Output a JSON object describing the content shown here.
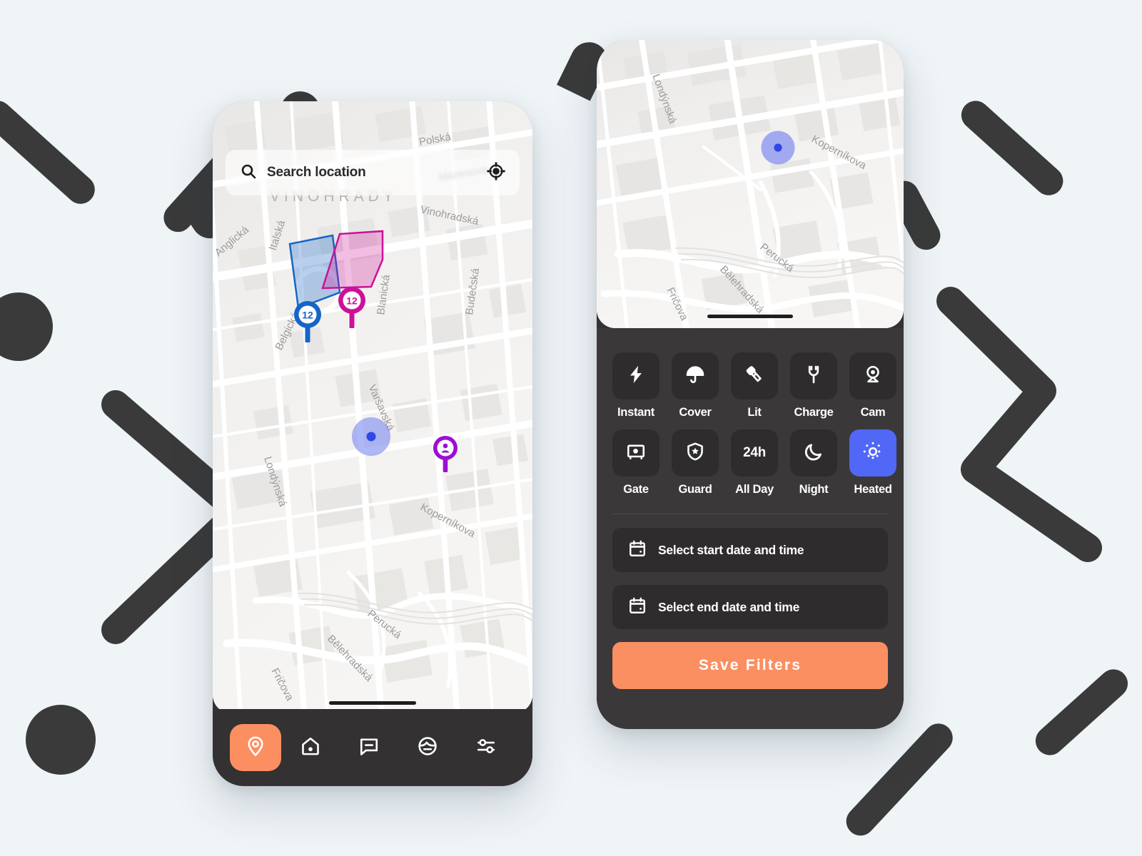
{
  "theme": {
    "background": "#eff4f7",
    "decor": "#3a3a3a",
    "phone_frame": "#333132",
    "panel": "#3a3839",
    "tile": "#2e2c2d",
    "accent_orange": "#fb8f62",
    "accent_blue": "#5167f6",
    "map_bg": "#f1efed",
    "pin_blue": "#1565c8",
    "pin_magenta": "#cc1199",
    "pin_purple": "#9b0fd4",
    "user_dot": "#6e7ef0"
  },
  "left_phone": {
    "search": {
      "placeholder": "Search location",
      "value": "Search location",
      "search_icon": "search-icon",
      "locate_icon": "crosshair-locate-icon"
    },
    "map": {
      "district_label": "VINOHRADY",
      "streets": [
        "Polská",
        "Mánesova",
        "Vinohradská",
        "Italská",
        "Anglická",
        "Blanická",
        "Budečská",
        "Belgická",
        "Varšavská",
        "Londýnská",
        "Koperníkova",
        "Perucká",
        "Bělehradská",
        "Fričova"
      ],
      "markers": [
        {
          "name": "cluster-blue",
          "label": "12",
          "color": "#1565c8"
        },
        {
          "name": "cluster-magenta",
          "label": "12",
          "color": "#cc1199"
        },
        {
          "name": "user-location-dot",
          "label": "",
          "color": "#6e7ef0"
        },
        {
          "name": "person-marker",
          "label": "",
          "color": "#9b0fd4"
        }
      ]
    },
    "bottom_nav": [
      {
        "icon": "map-pin-icon",
        "name": "nav-map",
        "active": true
      },
      {
        "icon": "home-icon",
        "name": "nav-home",
        "active": false
      },
      {
        "icon": "chat-bubble-icon",
        "name": "nav-messages",
        "active": false
      },
      {
        "icon": "face-avatar-icon",
        "name": "nav-profile",
        "active": false
      },
      {
        "icon": "sliders-icon",
        "name": "nav-filters",
        "active": false
      }
    ]
  },
  "right_phone": {
    "map": {
      "streets": [
        "Londýnská",
        "Koperníkova",
        "Perucká",
        "Bělehradská",
        "Fričova"
      ],
      "markers": [
        {
          "name": "user-location-dot",
          "color": "#6e7ef0"
        }
      ]
    },
    "filters": {
      "row1": [
        {
          "label": "Instant",
          "icon": "lightning-bolt-icon",
          "active": false
        },
        {
          "label": "Cover",
          "icon": "umbrella-icon",
          "active": false
        },
        {
          "label": "Lit",
          "icon": "flashlight-icon",
          "active": false
        },
        {
          "label": "Charge",
          "icon": "power-plug-icon",
          "active": false
        },
        {
          "label": "Cam",
          "icon": "webcam-icon",
          "active": false
        }
      ],
      "row2": [
        {
          "label": "Gate",
          "icon": "safe-vault-icon",
          "active": false
        },
        {
          "label": "Guard",
          "icon": "shield-star-icon",
          "active": false
        },
        {
          "label": "All Day",
          "icon": "24h-text-icon",
          "text": "24h",
          "active": false
        },
        {
          "label": "Night",
          "icon": "moon-icon",
          "active": false
        },
        {
          "label": "Heated",
          "icon": "sun-icon",
          "active": true
        }
      ]
    },
    "date_start": {
      "label": "Select start date and time",
      "icon": "calendar-icon"
    },
    "date_end": {
      "label": "Select end date and time",
      "icon": "calendar-icon"
    },
    "save_button": {
      "label": "Save Filters"
    }
  }
}
